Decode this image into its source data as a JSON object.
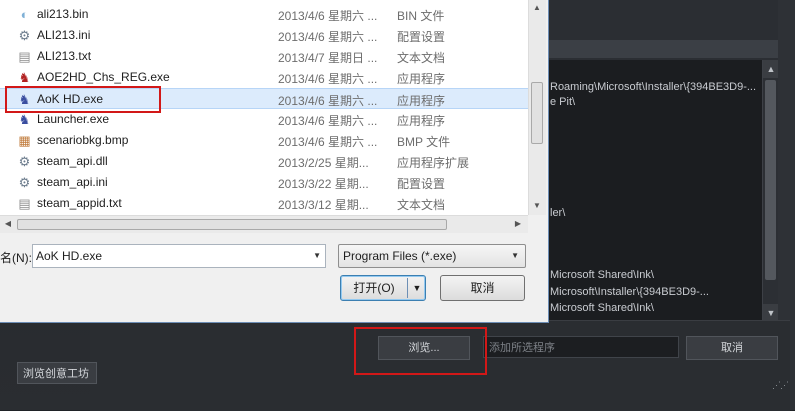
{
  "files": [
    {
      "name": "ali213.bin",
      "date": "2013/4/6 星期六 ...",
      "type": "BIN 文件",
      "icon": "bin-file-icon",
      "icon_glyph": "◐",
      "icon_color": "#7fb0d6",
      "selected": false
    },
    {
      "name": "ALI213.ini",
      "date": "2013/4/6 星期六 ...",
      "type": "配置设置",
      "icon": "ini-file-icon",
      "icon_glyph": "⚙",
      "icon_color": "#6b7b8c",
      "selected": false
    },
    {
      "name": "ALI213.txt",
      "date": "2013/4/7 星期日 ...",
      "type": "文本文档",
      "icon": "text-file-icon",
      "icon_glyph": "▤",
      "icon_color": "#8c8c8c",
      "selected": false
    },
    {
      "name": "AOE2HD_Chs_REG.exe",
      "date": "2013/4/6 星期六 ...",
      "type": "应用程序",
      "icon": "exe-red-icon",
      "icon_glyph": "♞",
      "icon_color": "#b22222",
      "selected": false
    },
    {
      "name": "AoK HD.exe",
      "date": "2013/4/6 星期六 ...",
      "type": "应用程序",
      "icon": "exe-game-icon",
      "icon_glyph": "♞",
      "icon_color": "#3a4ea0",
      "selected": true
    },
    {
      "name": "Launcher.exe",
      "date": "2013/4/6 星期六 ...",
      "type": "应用程序",
      "icon": "exe-game-icon",
      "icon_glyph": "♞",
      "icon_color": "#3a4ea0",
      "selected": false
    },
    {
      "name": "scenariobkg.bmp",
      "date": "2013/4/6 星期六 ...",
      "type": "BMP 文件",
      "icon": "image-file-icon",
      "icon_glyph": "▦",
      "icon_color": "#c07a3a",
      "selected": false
    },
    {
      "name": "steam_api.dll",
      "date": "2013/2/25 星期...",
      "type": "应用程序扩展",
      "icon": "dll-file-icon",
      "icon_glyph": "⚙",
      "icon_color": "#6b7b8c",
      "selected": false
    },
    {
      "name": "steam_api.ini",
      "date": "2013/3/22 星期...",
      "type": "配置设置",
      "icon": "ini-file-icon",
      "icon_glyph": "⚙",
      "icon_color": "#6b7b8c",
      "selected": false
    },
    {
      "name": "steam_appid.txt",
      "date": "2013/3/12 星期...",
      "type": "文本文档",
      "icon": "text-file-icon",
      "icon_glyph": "▤",
      "icon_color": "#8c8c8c",
      "selected": false
    }
  ],
  "filename": {
    "label": "名(N):",
    "value": "AoK HD.exe"
  },
  "filetype": {
    "value": "Program Files (*.exe)"
  },
  "buttons": {
    "open": "打开(O)",
    "cancel": "取消"
  },
  "log_lines": [
    "Roaming\\Microsoft\\Installer\\{394BE3D9-...",
    "e Pit\\",
    "ler\\",
    "Microsoft Shared\\Ink\\",
    "Microsoft\\Installer\\{394BE3D9-...",
    "Microsoft Shared\\Ink\\"
  ],
  "steam": {
    "browse": "浏览...",
    "add_placeholder": "添加所选程序",
    "cancel": "取消",
    "workshop": "浏览创意工坊"
  }
}
